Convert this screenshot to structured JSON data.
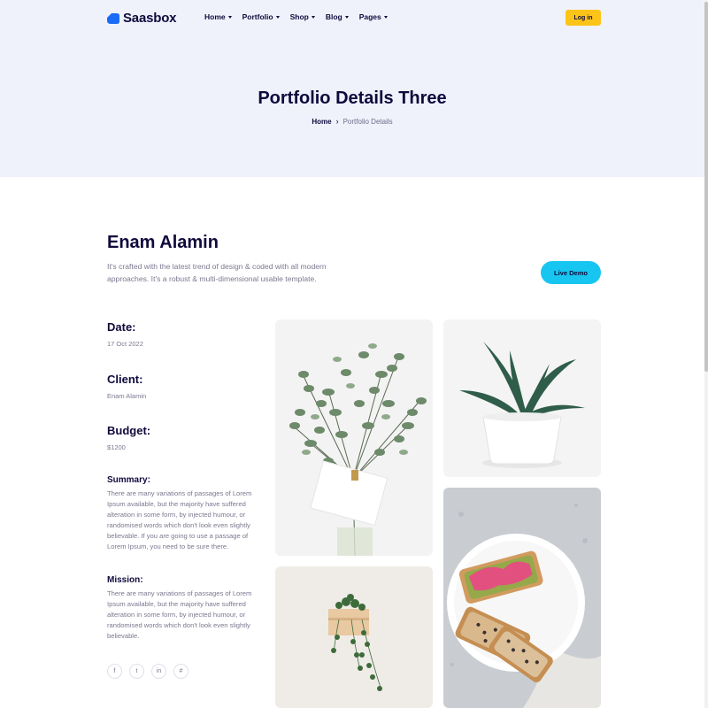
{
  "header": {
    "logo_text": "Saasbox",
    "nav": [
      {
        "label": "Home"
      },
      {
        "label": "Portfolio"
      },
      {
        "label": "Shop"
      },
      {
        "label": "Blog"
      },
      {
        "label": "Pages"
      }
    ],
    "login_label": "Log in"
  },
  "hero": {
    "title": "Portfolio Details Three",
    "breadcrumb": {
      "home": "Home",
      "separator": "›",
      "current": "Portfolio Details"
    }
  },
  "project": {
    "title": "Enam Alamin",
    "description": "It's crafted with the latest trend of design & coded with all modern approaches. It's a robust & multi-dimensional usable template.",
    "live_demo_label": "Live Demo"
  },
  "details": {
    "date_label": "Date:",
    "date_value": "17 Oct 2022",
    "client_label": "Client:",
    "client_value": "Enam Alamin",
    "budget_label": "Budget:",
    "budget_value": "$1200",
    "summary_label": "Summary:",
    "summary_text": "There are many variations of passages of Lorem Ipsum available, but the majority have suffered alteration in some form, by injected humour, or randomised words which don't look even slightly believable. If you are going to use a passage of Lorem Ipsum, you need to be sure there.",
    "mission_label": "Mission:",
    "mission_text": "There are many variations of passages of Lorem Ipsum available, but the majority have suffered alteration in some form, by injected humour, or randomised words which don't look even slightly believable."
  },
  "socials": [
    {
      "icon": "facebook-icon",
      "glyph": "f"
    },
    {
      "icon": "twitter-icon",
      "glyph": "t"
    },
    {
      "icon": "linkedin-icon",
      "glyph": "in"
    },
    {
      "icon": "slack-icon",
      "glyph": "#"
    }
  ],
  "colors": {
    "brand": "#0f0a3c",
    "hero_bg": "#f0f2fb",
    "login_button": "#fcc418",
    "live_demo_button": "#16c6f0",
    "logo_blue": "#1a6cf7"
  }
}
